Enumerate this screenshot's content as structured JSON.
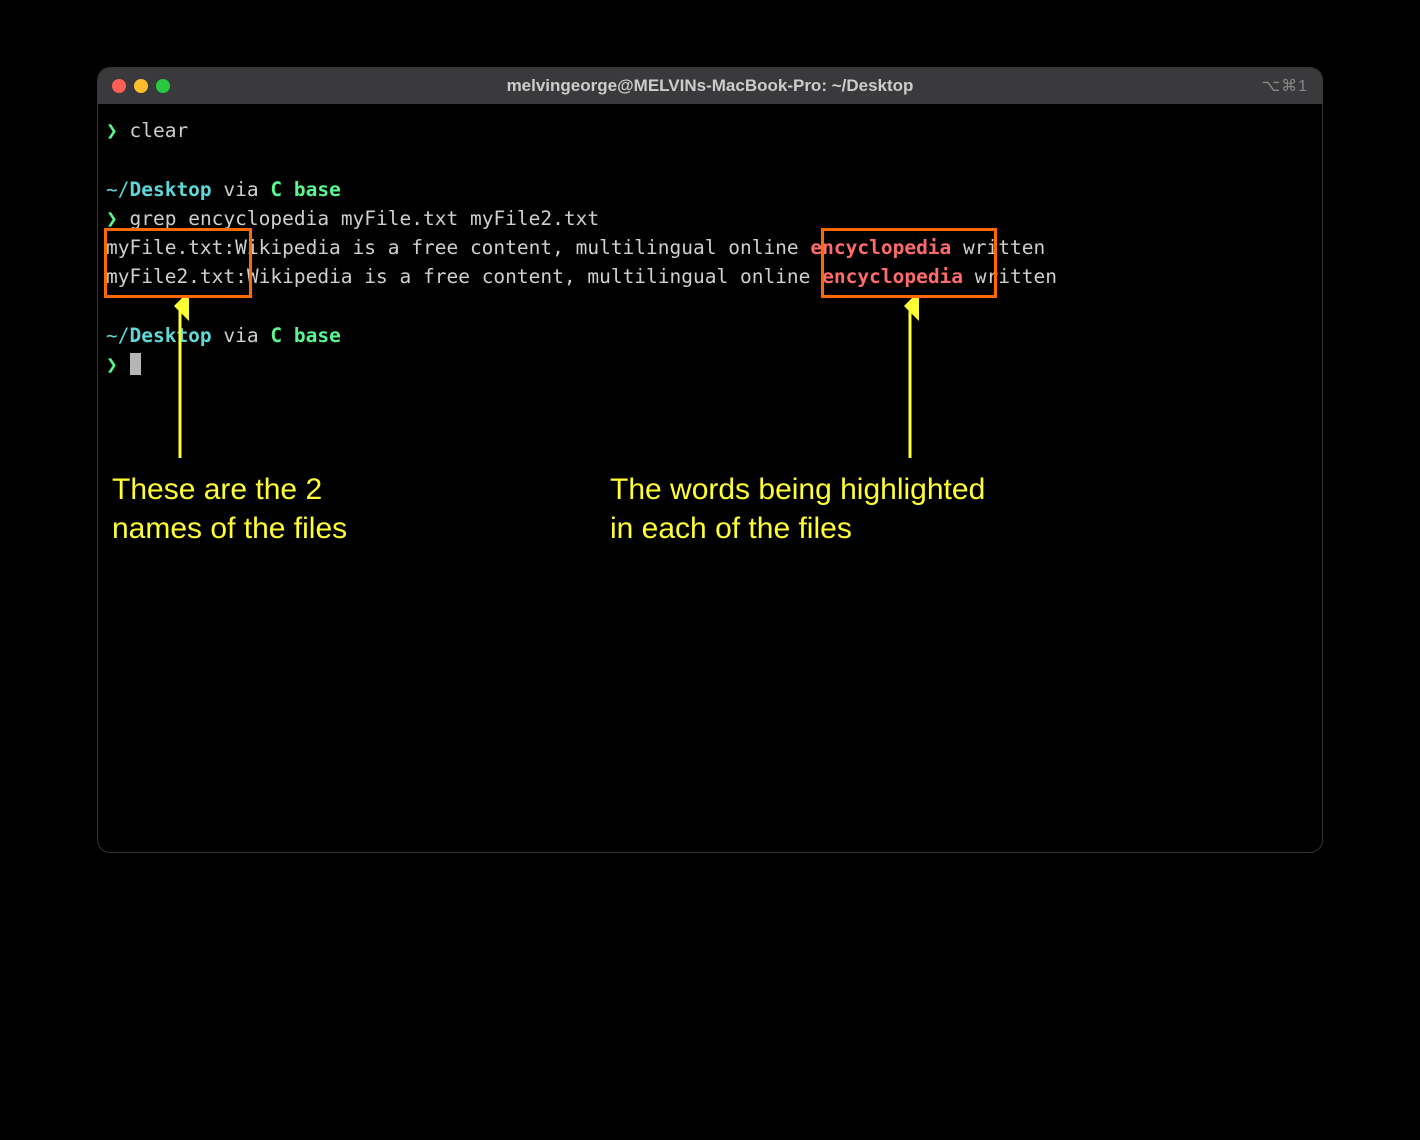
{
  "window": {
    "title": "melvingeorge@MELVINs-MacBook-Pro: ~/Desktop",
    "shortcut": "⌥⌘1"
  },
  "colors": {
    "traffic_red": "#ff5f57",
    "traffic_yellow": "#febc2e",
    "traffic_green": "#28c840",
    "annotation_border": "#ff6a00",
    "annotation_text": "#ffff33",
    "grep_match": "#ff6b6b",
    "prompt_green": "#5af78e",
    "path_cyan": "#5fd7d7"
  },
  "terminal": {
    "prompt_symbol": "❯",
    "command1": "clear",
    "path_segment_tilde": "~/",
    "path_segment_desktop": "Desktop",
    "via_text": " via ",
    "conda_prefix": "C ",
    "conda_env": "base",
    "command2": "grep encyclopedia myFile.txt myFile2.txt",
    "output": [
      {
        "filename": "myFile.txt:",
        "before": "Wikipedia is a free content, multilingual online ",
        "match": "encyclopedia",
        "after": " written"
      },
      {
        "filename": "myFile2.txt:",
        "before": "Wikipedia is a free content, multilingual online ",
        "match": "encyclopedia",
        "after": " written"
      }
    ]
  },
  "annotations": {
    "left": "These are the 2\nnames of the files",
    "right": "The words being highlighted\nin each of the files"
  }
}
